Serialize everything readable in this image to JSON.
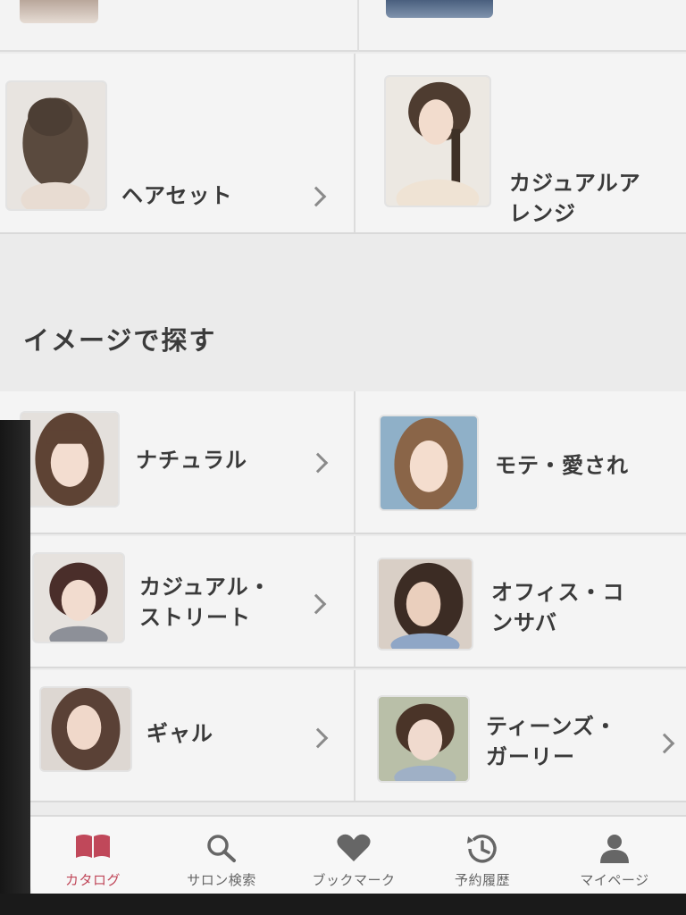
{
  "top_row": {
    "left": {
      "label": "ヘアセット"
    },
    "right": {
      "label_line1": "カジュアルア",
      "label_line2": "レンジ"
    }
  },
  "image_section": {
    "title": "イメージで探す",
    "items": [
      {
        "label_line1": "ナチュラル",
        "label_line2": ""
      },
      {
        "label_line1": "モテ・愛され",
        "label_line2": ""
      },
      {
        "label_line1": "カジュアル・",
        "label_line2": "ストリート"
      },
      {
        "label_line1": "オフィス・コ",
        "label_line2": "ンサバ"
      },
      {
        "label_line1": "ギャル",
        "label_line2": ""
      },
      {
        "label_line1": "ティーンズ・",
        "label_line2": "ガーリー"
      }
    ]
  },
  "tabbar": {
    "tabs": [
      {
        "label": "カタログ",
        "icon": "book-icon",
        "active": true
      },
      {
        "label": "サロン検索",
        "icon": "search-icon",
        "active": false
      },
      {
        "label": "ブックマーク",
        "icon": "heart-icon",
        "active": false
      },
      {
        "label": "予約履歴",
        "icon": "clock-icon",
        "active": false
      },
      {
        "label": "マイページ",
        "icon": "person-icon",
        "active": false
      }
    ]
  },
  "colors": {
    "accent": "#c0485a",
    "icon_gray": "#666666",
    "text": "#3a3a3a"
  }
}
